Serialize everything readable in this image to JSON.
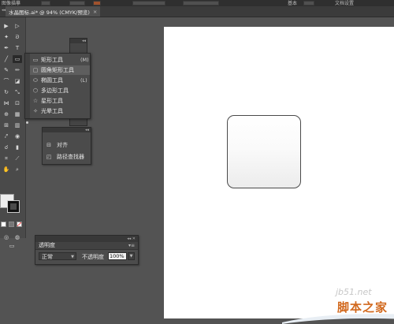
{
  "top_bar": {
    "left_text": "图像描摹",
    "right_label": "文档设置",
    "mid_label": "基本"
  },
  "document_tab": {
    "title": "水晶图标.ai* @ 94% (CMYK/预览)",
    "close": "×"
  },
  "flyout": {
    "items": [
      {
        "icon": "rectangle-icon",
        "label": "矩形工具",
        "shortcut": "(M)"
      },
      {
        "icon": "rounded-rectangle-icon",
        "label": "圆角矩形工具",
        "shortcut": "",
        "active": true
      },
      {
        "icon": "ellipse-icon",
        "label": "椭圆工具",
        "shortcut": "(L)"
      },
      {
        "icon": "polygon-icon",
        "label": "多边形工具",
        "shortcut": ""
      },
      {
        "icon": "star-icon",
        "label": "星形工具",
        "shortcut": ""
      },
      {
        "icon": "flare-icon",
        "label": "光晕工具",
        "shortcut": ""
      }
    ]
  },
  "align_panel": {
    "items": [
      {
        "icon": "align-icon",
        "label": "对齐"
      },
      {
        "icon": "pathfinder-icon",
        "label": "路径查找器"
      }
    ]
  },
  "transparency_panel": {
    "tab": "透明度",
    "blend_mode": "正常",
    "opacity_label": "不透明度",
    "opacity_value": "100%"
  },
  "colors": {
    "fill": "#ededed",
    "stroke": "#111111"
  },
  "watermark": {
    "url": "jb51.net",
    "name": "脚本之家"
  }
}
